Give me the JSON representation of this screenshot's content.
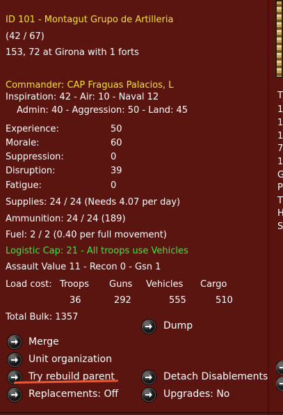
{
  "header": {
    "title": "ID 101 - Montagut Grupo de Artilleria",
    "count": "(42 / 67)",
    "location": "153, 72 at Girona with 1 forts"
  },
  "commander": {
    "title": "Commander: CAP Fraguas Palacios, L",
    "ratings_line1": "Inspiration: 42 - Air: 10 - Naval 12",
    "ratings_line2": "Admin: 40 - Aggression: 50 - Land: 45"
  },
  "stats": [
    {
      "label": "Experience:",
      "value": "50"
    },
    {
      "label": "Morale:",
      "value": "60"
    },
    {
      "label": "Suppression:",
      "value": "0"
    },
    {
      "label": "Disruption:",
      "value": "39"
    },
    {
      "label": "Fatigue:",
      "value": "0"
    }
  ],
  "supplies": {
    "supplies": "Supplies: 24 / 24 (Needs 4.07 per day)",
    "ammunition": "Ammunition: 24 / 24 (189)",
    "fuel": "Fuel: 2 / 2 (0.40 per full movement)",
    "logistic": "Logistic Cap: 21 - All troops use Vehicles",
    "assault": "Assault Value 11 - Recon 0 - Gsn 1"
  },
  "load": {
    "label": "Load cost:",
    "headers": [
      "Troops",
      "Guns",
      "Vehicles",
      "Cargo"
    ],
    "values": [
      "36",
      "292",
      "555",
      "510"
    ],
    "bulk": "Total Bulk: 1357"
  },
  "actions": {
    "dump": "Dump",
    "merge": "Merge",
    "unit_organization": "Unit organization",
    "try_rebuild_parent": "Try rebuild parent",
    "detach_disablements": "Detach Disablements",
    "replacements": "Replacements: Off",
    "upgrades": "Upgrades: No"
  },
  "right_panel": {
    "letters": [
      "T",
      "1",
      "1",
      "1",
      "7",
      "1",
      "G",
      "P",
      "T",
      "H",
      "S"
    ]
  }
}
